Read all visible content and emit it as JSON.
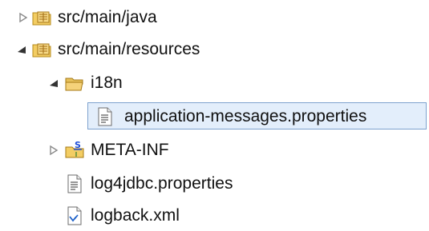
{
  "tree": {
    "rows": [
      {
        "label": "src/main/java",
        "expanded": false,
        "icon": "package-folder-icon"
      },
      {
        "label": "src/main/resources",
        "expanded": true,
        "icon": "package-folder-icon"
      },
      {
        "label": "i18n",
        "expanded": true,
        "icon": "open-folder-icon"
      },
      {
        "label": "application-messages.properties",
        "selected": true,
        "icon": "properties-file-icon"
      },
      {
        "label": "META-INF",
        "expanded": false,
        "icon": "spring-folder-icon",
        "badge": "S"
      },
      {
        "label": "log4jdbc.properties",
        "icon": "properties-file-icon"
      },
      {
        "label": "logback.xml",
        "icon": "xml-file-icon"
      }
    ]
  },
  "colors": {
    "selection_fill": "#e3eefb",
    "selection_border": "#7da2ce",
    "folder_yellow": "#f3cd63",
    "badge_blue": "#1f4fd8"
  }
}
